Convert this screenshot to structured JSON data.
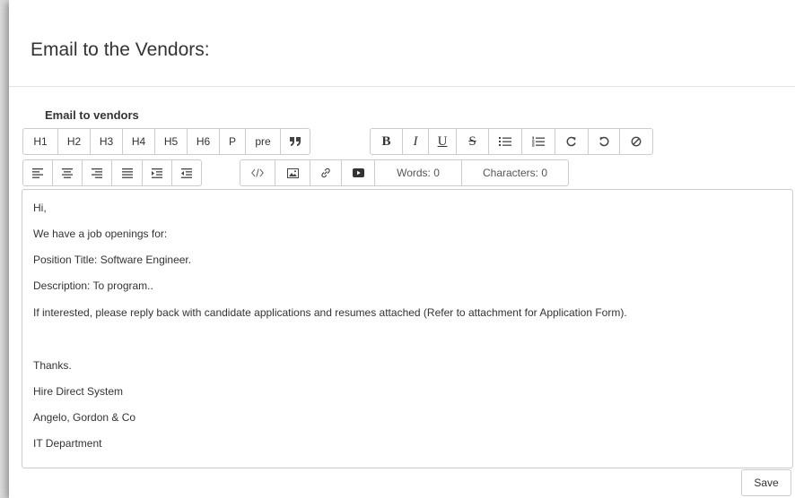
{
  "page": {
    "title": "Email to the Vendors:"
  },
  "form": {
    "label": "Email to vendors",
    "save_label": "Save"
  },
  "toolbar": {
    "headings": [
      "H1",
      "H2",
      "H3",
      "H4",
      "H5",
      "H6",
      "P",
      "pre"
    ],
    "quote_icon": "quote-icon",
    "format": {
      "bold": "B",
      "italic": "I",
      "underline": "U",
      "strike": "S"
    },
    "counters": {
      "words": "Words: 0",
      "characters": "Characters: 0"
    }
  },
  "editor": {
    "lines": [
      "Hi,",
      "We have a job openings for:",
      "Position Title: Software Engineer.",
      "Description: To program..",
      "If interested, please reply back with candidate applications and resumes attached (Refer to attachment for Application Form).",
      "Thanks.",
      "Hire Direct System",
      "Angelo, Gordon & Co",
      "IT Department"
    ]
  }
}
